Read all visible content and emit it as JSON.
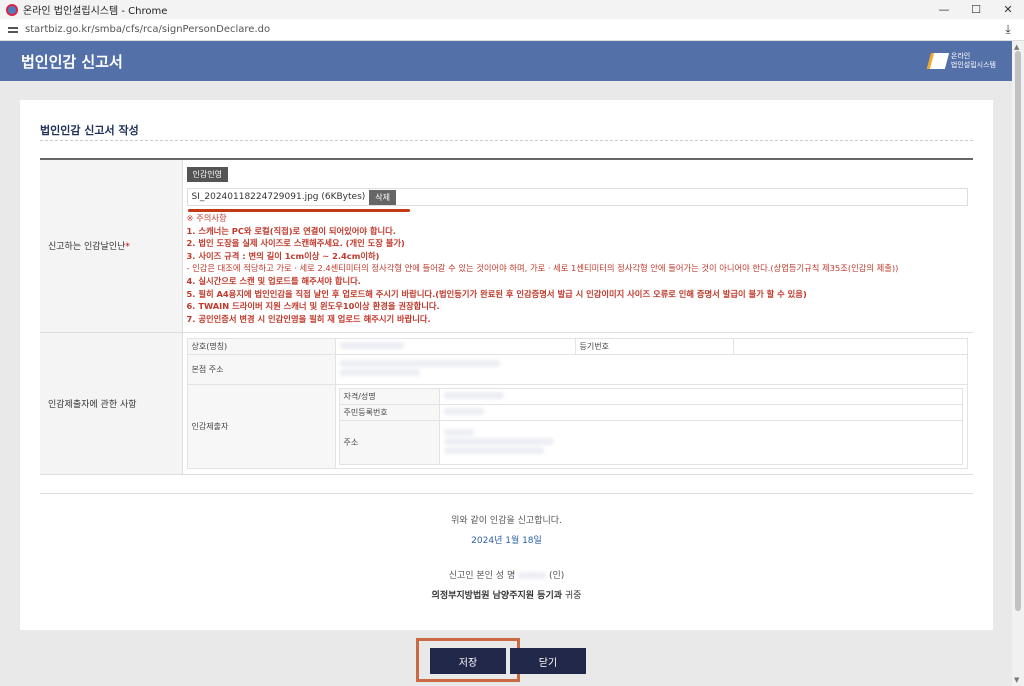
{
  "window": {
    "title": "온라인 법인설립시스템 - Chrome",
    "url": "startbiz.go.kr/smba/cfs/rca/signPersonDeclare.do"
  },
  "header": {
    "title": "법인인감 신고서",
    "brand_line1": "온라인",
    "brand_line2": "법인설립시스템"
  },
  "section": {
    "title": "법인인감 신고서 작성"
  },
  "seal": {
    "label": "신고하는 인감날인난",
    "required_mark": "*",
    "tag_button": "인감인영",
    "file_name": "SI_20240118224729091.jpg (6KBytes)",
    "delete_button": "삭제",
    "notes_header": "※ 주의사항",
    "notes": [
      "1. 스캐너는 PC와 로컬(직접)로 연결이 되어있어야 합니다.",
      "2. 법인 도장을 실제 사이즈로 스캔해주세요. (개인 도장 불가)",
      "3. 사이즈 규격 : 변의 길이 1cm이상 ~ 2.4cm이하)",
      "- 인감은 대조에 적당하고 가로 · 세로 2.4센티미터의 정사각형 안에 들어갈 수 있는 것이어야 하며, 가로 · 세로 1센티미터의 정사각형 안에 들어가는 것이 아니어야 한다.(상업등기규칙 제35조(인감의 제출))",
      "4. 실시간으로 스캔 및 업로드를 해주셔야 합니다.",
      "5. 필히 A4용지에 법인인감을 직접 날인 후 업로드해 주시기 바랍니다.(법인등기가 완료된 후 인감증명서 발급 시 인감이미지 사이즈 오류로 인해 증명서 발급이 불가 할 수 있음)",
      "6. TWAIN 드라이버 지원 스캐너 및 윈도우10이상 환경을 권장합니다.",
      "7. 공인인증서 변경 시 인감인영을 필히 재 업로드 해주시기 바랍니다."
    ]
  },
  "submitter": {
    "label": "인감제출자에 관한 사항",
    "company_name": "상호(명칭)",
    "reg_no": "등기번호",
    "head_office": "본점 주소",
    "submitter": "인감제출자",
    "qual_name": "자격/성명",
    "resident_no": "주민등록번호",
    "address": "주소"
  },
  "footer": {
    "declare": "위와 같이 인감을 신고합니다.",
    "date": "2024년 1월 18일",
    "signer_prefix": "신고인 본인 성 명",
    "signer_suffix": "(인)",
    "court_bold": "의정부지방법원 남양주지원 등기과",
    "court_suffix": " 귀중"
  },
  "buttons": {
    "save": "저장",
    "close": "닫기"
  }
}
